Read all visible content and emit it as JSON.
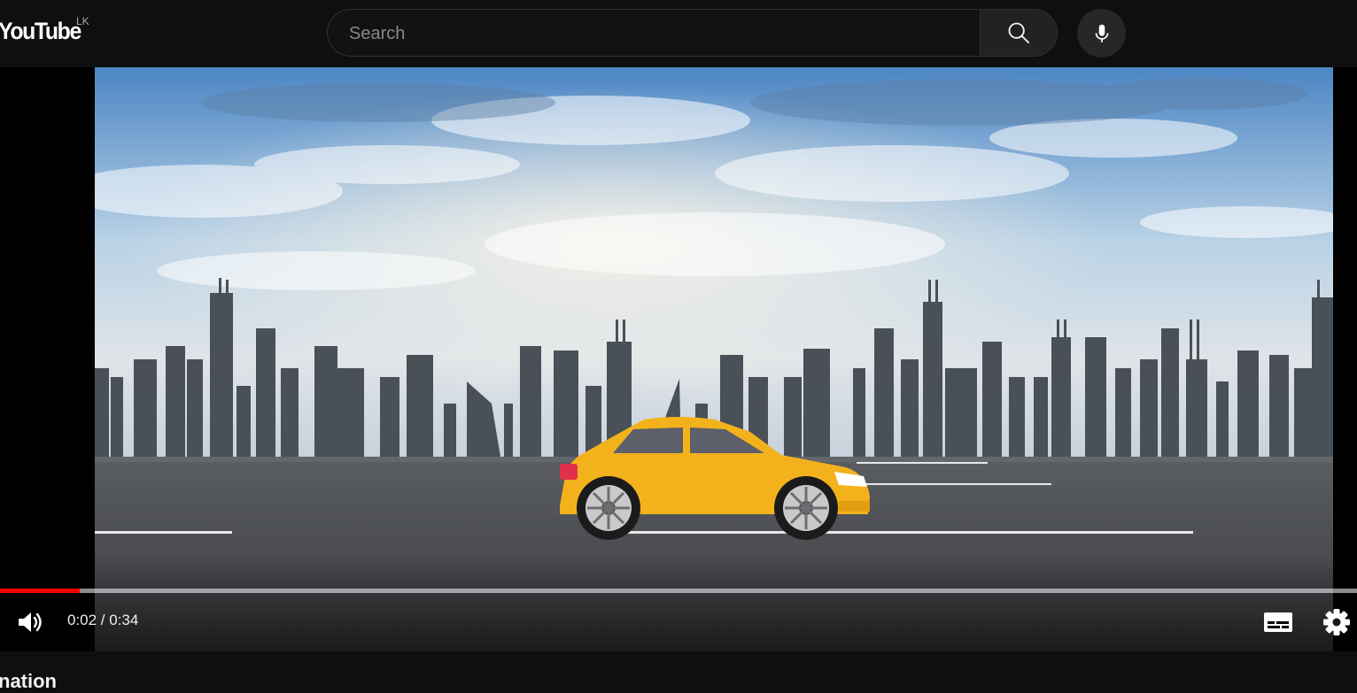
{
  "header": {
    "logo_text": "YouTube",
    "country_code": "LK",
    "search": {
      "placeholder": "Search",
      "value": ""
    }
  },
  "player": {
    "current_time": "0:02",
    "duration": "0:34",
    "time_display": "0:02 / 0:34",
    "progress_fraction": 0.059,
    "accent_color": "#ff0000"
  },
  "video_title_partial": "nation",
  "icons": [
    "search-icon",
    "mic-icon",
    "volume-icon",
    "subtitles-icon",
    "settings-icon"
  ]
}
